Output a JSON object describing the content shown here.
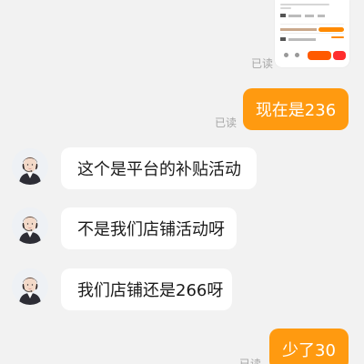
{
  "chat": {
    "shared_card": {
      "icon": "shared-screenshot-thumbnail"
    },
    "read_status": "已读",
    "messages": [
      {
        "side": "out",
        "text": "现在是236",
        "status": "已读"
      },
      {
        "side": "in",
        "text": "这个是平台的补贴活动",
        "avatar": "agent-avatar"
      },
      {
        "side": "in",
        "text": "不是我们店铺活动呀",
        "avatar": "agent-avatar"
      },
      {
        "side": "in",
        "text": "我们店铺还是266呀",
        "avatar": "agent-avatar"
      },
      {
        "side": "out",
        "text": "少了30",
        "status": "已读"
      }
    ]
  },
  "colors": {
    "background": "#f2f2f2",
    "outgoing_bubble": "#ff9a10",
    "incoming_bubble": "#ffffff",
    "read_text": "#a6a6a6"
  }
}
